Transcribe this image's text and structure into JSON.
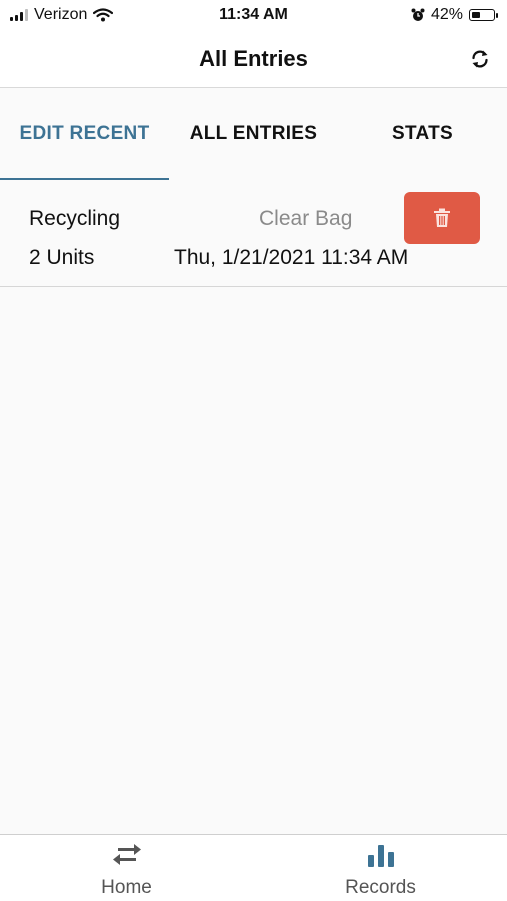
{
  "status_bar": {
    "carrier": "Verizon",
    "time": "11:34 AM",
    "battery": "42%",
    "battery_level": 0.42
  },
  "nav": {
    "title": "All Entries",
    "refresh_icon": "refresh-icon"
  },
  "tabs": [
    {
      "label": "EDIT RECENT",
      "active": true
    },
    {
      "label": "ALL ENTRIES",
      "active": false
    },
    {
      "label": "STATS",
      "active": false
    }
  ],
  "entries": [
    {
      "type": "Recycling",
      "quantity": "2 Units",
      "action": "Clear Bag",
      "datetime": "Thu, 1/21/2021 11:34 AM",
      "delete_icon": "trash-icon"
    }
  ],
  "bottom_nav": [
    {
      "label": "Home",
      "icon": "transfer-arrows-icon",
      "color": "#555555"
    },
    {
      "label": "Records",
      "icon": "bar-chart-icon",
      "color": "#3d7394"
    }
  ],
  "colors": {
    "accent": "#3d7394",
    "delete": "#e05a45"
  }
}
